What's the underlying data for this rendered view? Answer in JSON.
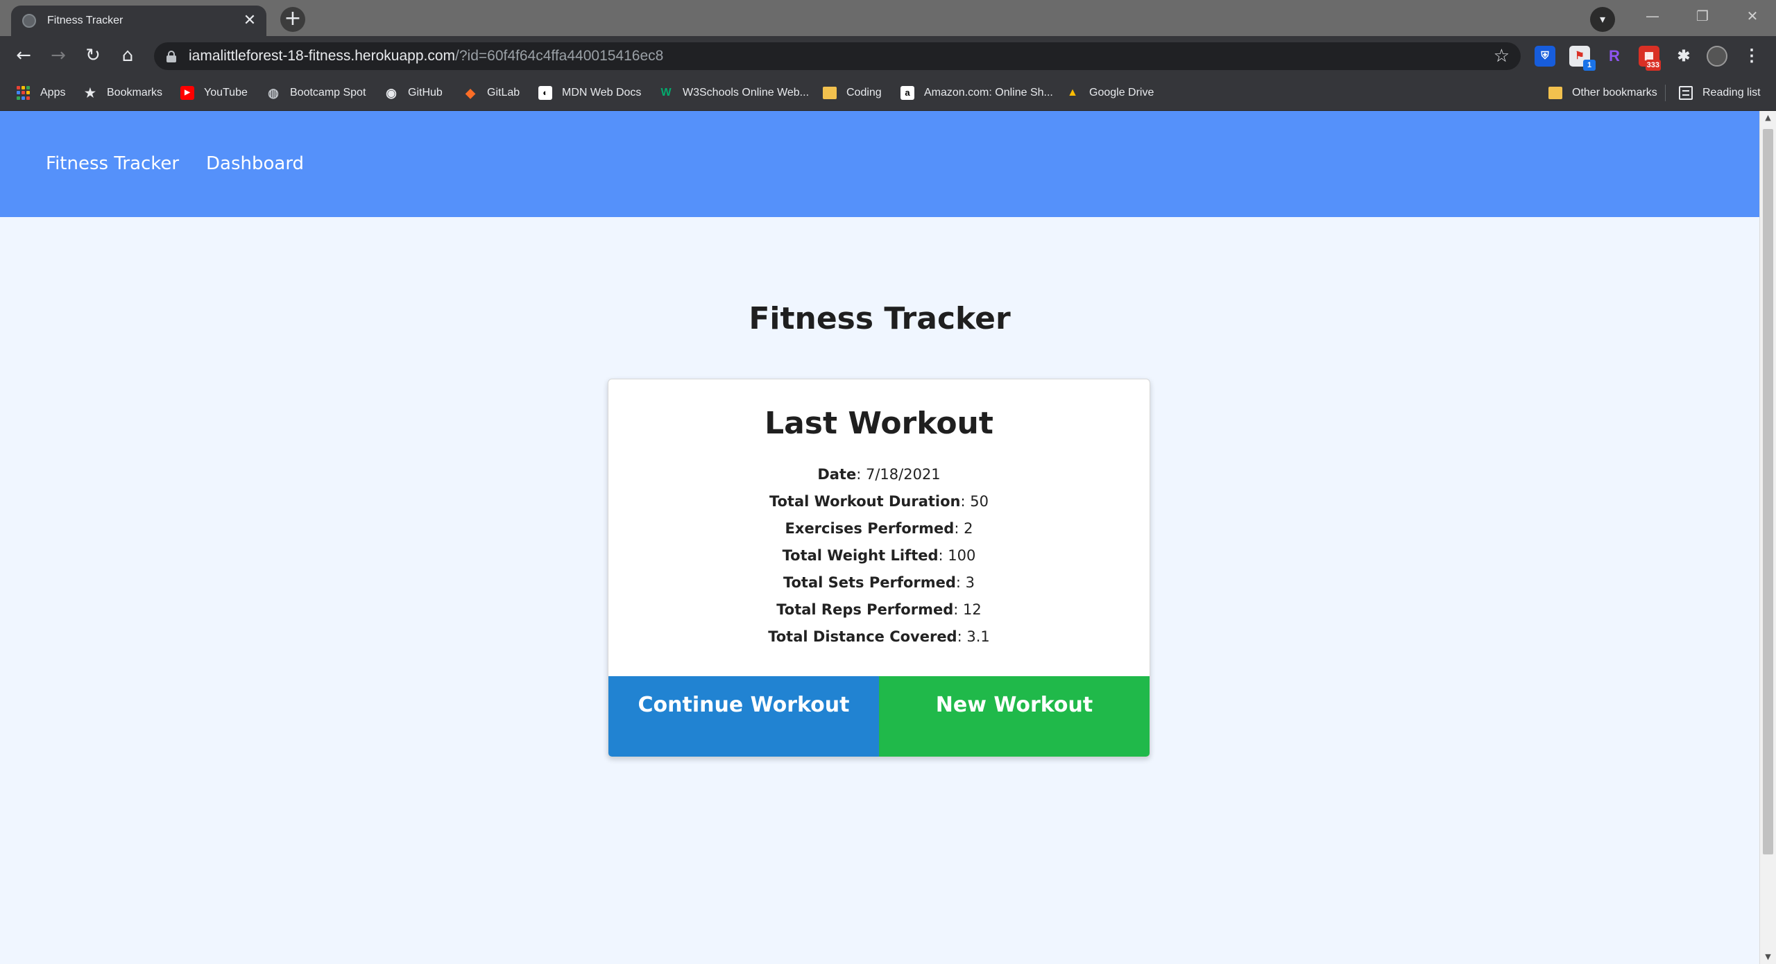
{
  "browser": {
    "tab": {
      "title": "Fitness Tracker",
      "close_glyph": "✕"
    },
    "new_tab_glyph": "+",
    "window_controls": {
      "minimize": "—",
      "restore": "❐",
      "close": "✕"
    },
    "nav": {
      "back": "←",
      "forward": "→",
      "reload": "↻",
      "home": "⌂"
    },
    "address": {
      "host": "iamalittleforest-18-fitness.herokuapp.com",
      "path": "/?id=60f4f64c4ffa440015416ec8"
    },
    "star_glyph": "☆",
    "extensions": [
      {
        "name": "bitwarden-icon",
        "glyph": "⛨",
        "color": "#175ddc",
        "badge": ""
      },
      {
        "name": "extension-flag-icon",
        "glyph": "⚑",
        "color": "#d93025",
        "badge": "1",
        "badge_color": "#1a73e8"
      },
      {
        "name": "extension-r-icon",
        "glyph": "R",
        "color": "#7b3fe4",
        "badge": ""
      },
      {
        "name": "extension-calendar-icon",
        "glyph": "▦",
        "color": "#d93025",
        "badge": "333",
        "badge_color": "#d93025"
      }
    ],
    "puzzle_glyph": "✱",
    "menu_glyph": "⋮"
  },
  "bookmarks": {
    "items": [
      {
        "label": "Apps",
        "icon": "apps-grid-icon"
      },
      {
        "label": "Bookmarks",
        "icon": "star-icon",
        "glyph": "★",
        "color": "#35363a",
        "text_color": "#e8eaed"
      },
      {
        "label": "YouTube",
        "icon": "youtube-icon",
        "glyph": "▶",
        "color": "#ff0000",
        "text_color": "#ffffff"
      },
      {
        "label": "Bootcamp Spot",
        "icon": "globe-icon",
        "glyph": "◍",
        "color": "#35363a",
        "text_color": "#bdc1c6"
      },
      {
        "label": "GitHub",
        "icon": "github-icon",
        "glyph": "◉",
        "color": "#35363a",
        "text_color": "#e8eaed"
      },
      {
        "label": "GitLab",
        "icon": "gitlab-icon",
        "glyph": "◆",
        "color": "#35363a",
        "text_color": "#fc6d26"
      },
      {
        "label": "MDN Web Docs",
        "icon": "mdn-icon",
        "glyph": "◐",
        "color": "#ffffff",
        "text_color": "#000000"
      },
      {
        "label": "W3Schools Online Web...",
        "icon": "w3schools-icon",
        "glyph": "W",
        "color": "#35363a",
        "text_color": "#04aa6d"
      },
      {
        "label": "Coding",
        "icon": "folder-icon"
      },
      {
        "label": "Amazon.com: Online Sh...",
        "icon": "amazon-icon",
        "glyph": "a",
        "color": "#ffffff",
        "text_color": "#000000"
      },
      {
        "label": "Google Drive",
        "icon": "google-drive-icon",
        "glyph": "▲",
        "color": "#35363a",
        "text_color": "#fbbc04"
      }
    ],
    "other": "Other bookmarks",
    "reading_list": "Reading list"
  },
  "site": {
    "nav": {
      "brand": "Fitness Tracker",
      "dashboard": "Dashboard"
    },
    "heading": "Fitness Tracker",
    "card": {
      "title": "Last Workout",
      "stats": [
        {
          "label": "Date",
          "value": "7/18/2021"
        },
        {
          "label": "Total Workout Duration",
          "value": "50"
        },
        {
          "label": "Exercises Performed",
          "value": "2"
        },
        {
          "label": "Total Weight Lifted",
          "value": "100"
        },
        {
          "label": "Total Sets Performed",
          "value": "3"
        },
        {
          "label": "Total Reps Performed",
          "value": "12"
        },
        {
          "label": "Total Distance Covered",
          "value": "3.1"
        }
      ],
      "continue_label": "Continue Workout",
      "new_label": "New Workout"
    }
  },
  "colors": {
    "navbar": "#5591fa",
    "page_bg": "#f0f6ff",
    "continue_button": "#2183d2",
    "new_button": "#20b94a"
  }
}
